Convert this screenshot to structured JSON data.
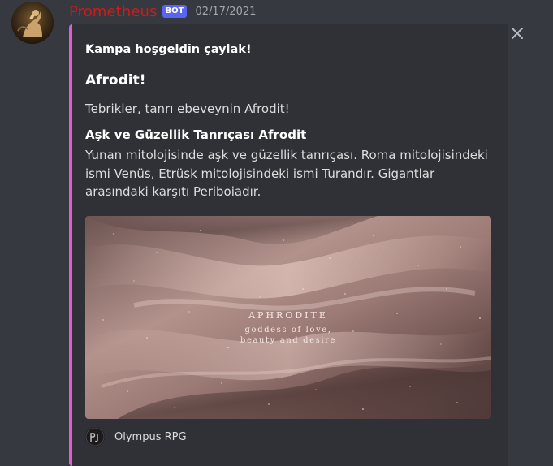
{
  "message": {
    "username": "Prometheus",
    "username_color": "#d11a1a",
    "bot_tag": "BOT",
    "timestamp": "02/17/2021",
    "avatar_icon": "prometheus-avatar"
  },
  "embed": {
    "accent_color": "#e15bd5",
    "author": "Kampa hoşgeldin çaylak!",
    "title": "Afrodit!",
    "description": "Tebrikler, tanrı ebeveynin Afrodit!",
    "field": {
      "name": "Aşk ve Güzellik Tanrıçası Afrodit",
      "value": "Yunan mitolojisinde aşk ve güzellik tanrıçası. Roma mitolojisindeki ismi Venüs, Etrüsk mitolojisindeki ismi Turandır. Gigantlar arasındaki karşıtı Periboiadır."
    },
    "image": {
      "title": "APHRODITE",
      "subtitle_line1": "goddess of love,",
      "subtitle_line2": "beauty and desire"
    },
    "footer": {
      "text": "Olympus RPG",
      "icon": "olympus-logo"
    }
  },
  "controls": {
    "close_icon": "close-icon"
  }
}
